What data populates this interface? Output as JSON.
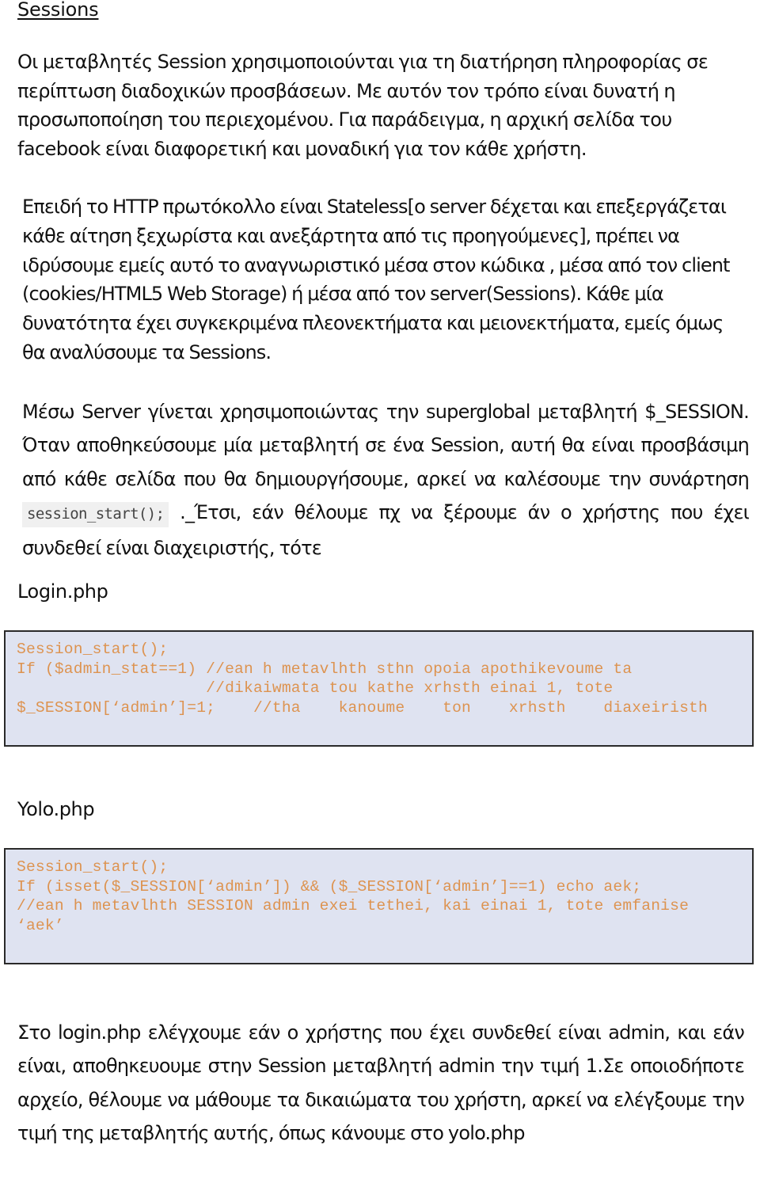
{
  "document": {
    "title": "Sessions",
    "paragraphs": {
      "intro": "Οι μεταβλητές Session χρησιμοποιούνται για τη διατήρηση πληροφορίας σε περίπτωση διαδοχικών προσβάσεων. Με αυτόν τον τρόπο είναι δυνατή η προσωποποίηση του περιεχομένου. Για παράδειγμα, η αρχική σελίδα του facebook είναι διαφορετική και μοναδική για τον κάθε χρήστη.",
      "stateless": "Επειδή το HTTP πρωτόκολλο είναι Stateless[ο server δέχεται και επεξεργάζεται κάθε αίτηση ξεχωρίστα και ανεξάρτητα από τις προηγούμενες], πρέπει να ιδρύσουμε εμείς αυτό το αναγνωριστικό μέσα στον κώδικα , μέσα από τον client (cookies/HTML5 Web Storage) ή μέσα από τον server(Sessions). Κάθε μία δυνατότητα έχει συγκεκριμένα πλεονεκτήματα και μειονεκτήματα, εμείς όμως θα αναλύσουμε τα Sessions.",
      "server_before": "Μέσω Server γίνεται χρησιμοποιώντας την superglobal μεταβλητή $_SESSION. Όταν αποθηκεύσουμε μία μεταβλητή σε ένα Session, αυτή θα είναι προσβάσιμη από κάθε σελίδα που θα δημιουργήσουμε, αρκεί να καλέσουμε την συνάρτηση ",
      "server_inline_code": "session_start();",
      "server_after": " ._Έτσι, εάν θέλουμε πχ να ξέρουμε άν ο χρήστης που έχει συνδεθεί είναι διαχειριστής, τότε",
      "summary": "Στο login.php ελέγχουμε εάν  ο χρήστης που έχει συνδεθεί είναι admin, και εάν είναι, αποθηκευουμε στην Session μεταβλητή admin την τιμή 1.Σε οποιοδήποτε αρχείο, θέλουμε να μάθουμε τα δικαιώματα του χρήστη, αρκεί να ελέγξουμε την τιμή της μεταβλητής αυτής, όπως κάνουμε στο yolo.php"
    },
    "code_samples": {
      "login": {
        "label": "Login.php",
        "lines": [
          "Session_start();",
          "If ($admin_stat==1) //ean h metavlhth sthn opoia apothikevoume ta",
          "                    //dikaiwmata tou kathe xrhsth einai 1, tote",
          "$_SESSION[‘admin’]=1;    //tha    kanoume    ton    xrhsth    diaxeiristh"
        ]
      },
      "yolo": {
        "label": "Yolo.php",
        "lines": [
          "Session_start();",
          "If (isset($_SESSION[‘admin’]) && ($_SESSION[‘admin’]==1) echo aek;",
          "//ean h metavlhth SESSION admin exei tethei, kai einai 1, tote emfanise",
          "‘aek’"
        ]
      }
    },
    "colors": {
      "code_text": "#dd9350",
      "code_background": "#dfe3f1",
      "code_border": "#2a2a2a",
      "inline_code_background": "#f0f0f0"
    }
  }
}
